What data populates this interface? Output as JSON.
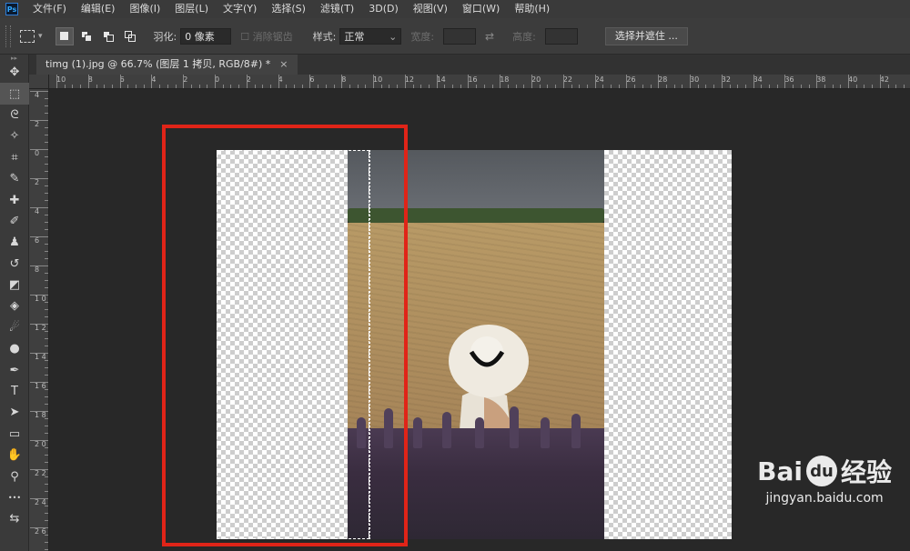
{
  "menubar": {
    "app_logo": "Ps",
    "items": [
      "文件(F)",
      "编辑(E)",
      "图像(I)",
      "图层(L)",
      "文字(Y)",
      "选择(S)",
      "滤镜(T)",
      "3D(D)",
      "视图(V)",
      "窗口(W)",
      "帮助(H)"
    ]
  },
  "options": {
    "feather_label": "羽化:",
    "feather_value": "0 像素",
    "antialias_label": "消除锯齿",
    "style_label": "样式:",
    "style_value": "正常",
    "width_label": "宽度:",
    "height_label": "高度:",
    "select_mask_button": "选择并遮住 ..."
  },
  "document": {
    "tab_title": "timg (1).jpg @ 66.7% (图层 1 拷贝, RGB/8#) *",
    "close_glyph": "×"
  },
  "ruler": {
    "h_labels": [
      "10",
      "8",
      "6",
      "4",
      "2",
      "0",
      "2",
      "4",
      "6",
      "8",
      "10",
      "12",
      "14",
      "16",
      "18",
      "20",
      "22",
      "24",
      "26",
      "28",
      "30",
      "32",
      "34",
      "36",
      "38",
      "40",
      "42"
    ],
    "v_labels": [
      "4",
      "2",
      "0",
      "2",
      "4",
      "6",
      "8",
      "1 0",
      "1 2",
      "1 4",
      "1 6",
      "1 8",
      "2 0",
      "2 2",
      "2 4",
      "2 6"
    ]
  },
  "tools": [
    {
      "name": "move-tool",
      "glyph": "✥"
    },
    {
      "name": "rect-marquee-tool",
      "glyph": "⬚"
    },
    {
      "name": "lasso-tool",
      "glyph": "ᘓ"
    },
    {
      "name": "magic-wand-tool",
      "glyph": "✧"
    },
    {
      "name": "crop-tool",
      "glyph": "⌗"
    },
    {
      "name": "eyedropper-tool",
      "glyph": "✎"
    },
    {
      "name": "healing-tool",
      "glyph": "✚"
    },
    {
      "name": "brush-tool",
      "glyph": "✐"
    },
    {
      "name": "stamp-tool",
      "glyph": "♟"
    },
    {
      "name": "history-brush-tool",
      "glyph": "↺"
    },
    {
      "name": "eraser-tool",
      "glyph": "◩"
    },
    {
      "name": "bucket-tool",
      "glyph": "◈"
    },
    {
      "name": "smudge-tool",
      "glyph": "☄"
    },
    {
      "name": "dodge-tool",
      "glyph": "●"
    },
    {
      "name": "pen-tool",
      "glyph": "✒"
    },
    {
      "name": "type-tool",
      "glyph": "T"
    },
    {
      "name": "path-select-tool",
      "glyph": "➤"
    },
    {
      "name": "rectangle-tool",
      "glyph": "▭"
    },
    {
      "name": "hand-tool",
      "glyph": "✋"
    },
    {
      "name": "zoom-tool",
      "glyph": "⚲"
    },
    {
      "name": "more-tools",
      "glyph": "•••"
    },
    {
      "name": "swap-colors",
      "glyph": "⇆"
    }
  ],
  "watermark": {
    "brand": "Bai",
    "paw": "du",
    "suffix": "经验",
    "url": "jingyan.baidu.com"
  },
  "colors": {
    "highlight_box": "#e02418",
    "workspace": "#282828"
  }
}
